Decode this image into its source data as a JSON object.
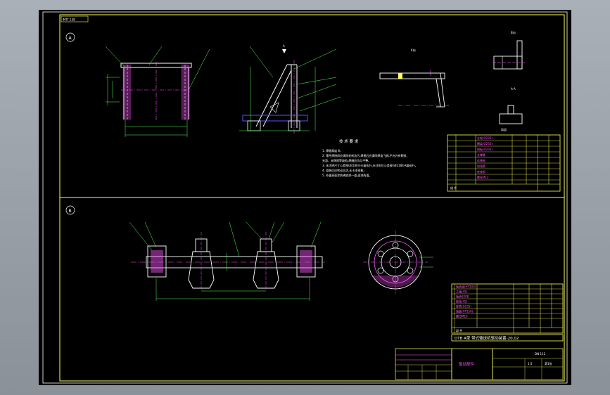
{
  "drawing": {
    "code_box": "ΦЛГ-138",
    "view_a_label": "A",
    "view_b_label": "B",
    "section_a_mark": "A",
    "view_label_k": "K向",
    "view_label_b": "B向",
    "view_label_a": "A-A",
    "view_label_c": "局部",
    "callouts_a": [
      "3",
      "1",
      "6",
      "5",
      "1",
      "4",
      "2",
      "3",
      "7"
    ],
    "callouts_b": [
      "7",
      "8",
      "5",
      "4",
      "3",
      "2",
      "1"
    ],
    "tech_title": "技 术 要 求",
    "tech_lines": [
      "1. 焊缝高度 8。",
      "2. 零件焊接前应清除毛刺油污,焊接后应清除焊渣飞溅,不允许有裂纹、",
      "夹渣、未焊透等缺陷,焊缝应均匀平整。",
      "3. 未注明尺寸公差按GB1804-m级执行,未注形位公差按GB1184-K级执行。",
      "4. 组装后应转动灵活,无卡滞现象。",
      "5. 外露表面涂防锈底漆一道,面漆两道。"
    ],
    "bom_a_rows": [
      "支架(Q235)",
      "横梁(Q235)",
      "侧板(Q235)",
      "支撑管",
      "连接板",
      "加强筋",
      "底座板",
      "螺栓M12"
    ],
    "bom_a_footer": "组 件",
    "bom_b_rows": [
      "轴承座(HT200)",
      "主轴(45)",
      "轴承6208",
      "链轮(45)",
      "套筒(Q235)",
      "端盖(HT150)",
      "螺母M16"
    ],
    "bom_b_footer": "部 件",
    "title_main": "DTB A型 带式输送机驱动装置-20.02",
    "title_sub": "驱动部件",
    "title_scale": "1:5",
    "title_sheet": "第1张",
    "title_no": "DN-112"
  }
}
